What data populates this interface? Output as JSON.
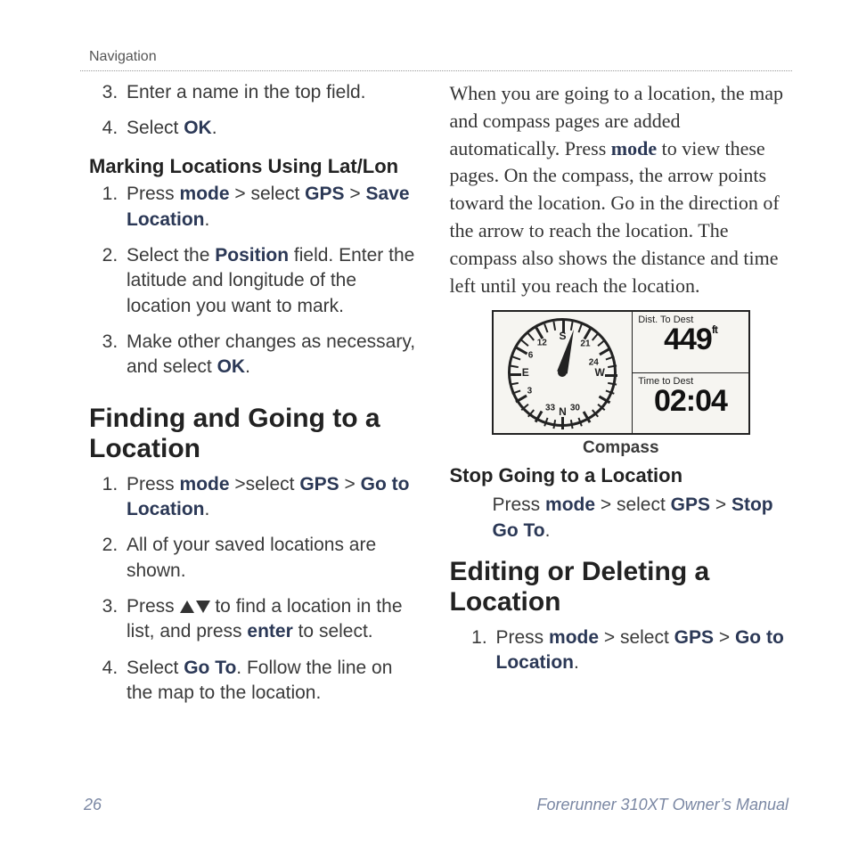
{
  "header": "Navigation",
  "col1": {
    "list1": {
      "start": 3,
      "item3": "Enter a name in the top field.",
      "item4_a": "Select ",
      "item4_b": "OK",
      "item4_c": "."
    },
    "h3": "Marking Locations Using Lat/Lon",
    "list2": {
      "i1_a": "Press ",
      "i1_b": "mode",
      "i1_c": "  > select ",
      "i1_d": "GPS",
      "i1_e": " > ",
      "i1_f": "Save Location",
      "i1_g": ".",
      "i2_a": "Select the ",
      "i2_b": "Position",
      "i2_c": " field. Enter the latitude and longitude of the location you want to mark.",
      "i3_a": "Make other changes as necessary, and select ",
      "i3_b": "OK",
      "i3_c": "."
    },
    "h2": "Finding and Going to a Location",
    "list3": {
      "i1_a": "Press ",
      "i1_b": "mode",
      "i1_c": " >select ",
      "i1_d": "GPS",
      "i1_e": " > ",
      "i1_f": "Go to Location",
      "i1_g": ".",
      "i2": "All of your saved locations are shown.",
      "i3_a": "Press ",
      "i3_b": " to find a location in the list, and press ",
      "i3_c": "enter",
      "i3_d": " to select.",
      "i4_a": "Select ",
      "i4_b": "Go To",
      "i4_c": ". Follow the line on the map to the location."
    }
  },
  "col2": {
    "para_a": "When you are going to a location, the map and compass pages are added automatically. Press ",
    "para_b": "mode",
    "para_c": " to view these pages. On the compass, the arrow points toward the location. Go in the direction of the arrow to reach the location. The compass also shows the distance and time left until you reach the location.",
    "compass": {
      "caption": "Compass",
      "dist_label": "Dist. To Dest",
      "dist_value": "449",
      "dist_unit": "ft",
      "time_label": "Time to Dest",
      "time_value": "02:04",
      "dirs": {
        "n": "N",
        "s": "S",
        "e": "E",
        "w": "W"
      },
      "nums": {
        "t12": "12",
        "t21": "21",
        "t24": "24",
        "t30": "30",
        "t33": "33",
        "t3": "3",
        "t6": "6"
      }
    },
    "h3b": "Stop Going to a Location",
    "stop_a": "Press ",
    "stop_b": "mode",
    "stop_c": " > select ",
    "stop_d": "GPS",
    "stop_e": " > ",
    "stop_f": "Stop Go To",
    "stop_g": ".",
    "h2b": "Editing or Deleting a Location",
    "list4": {
      "i1_a": "Press ",
      "i1_b": "mode",
      "i1_c": " > select ",
      "i1_d": "GPS",
      "i1_e": " > ",
      "i1_f": "Go to Location",
      "i1_g": "."
    }
  },
  "footer": {
    "page": "26",
    "title": "Forerunner 310XT Owner’s Manual"
  }
}
